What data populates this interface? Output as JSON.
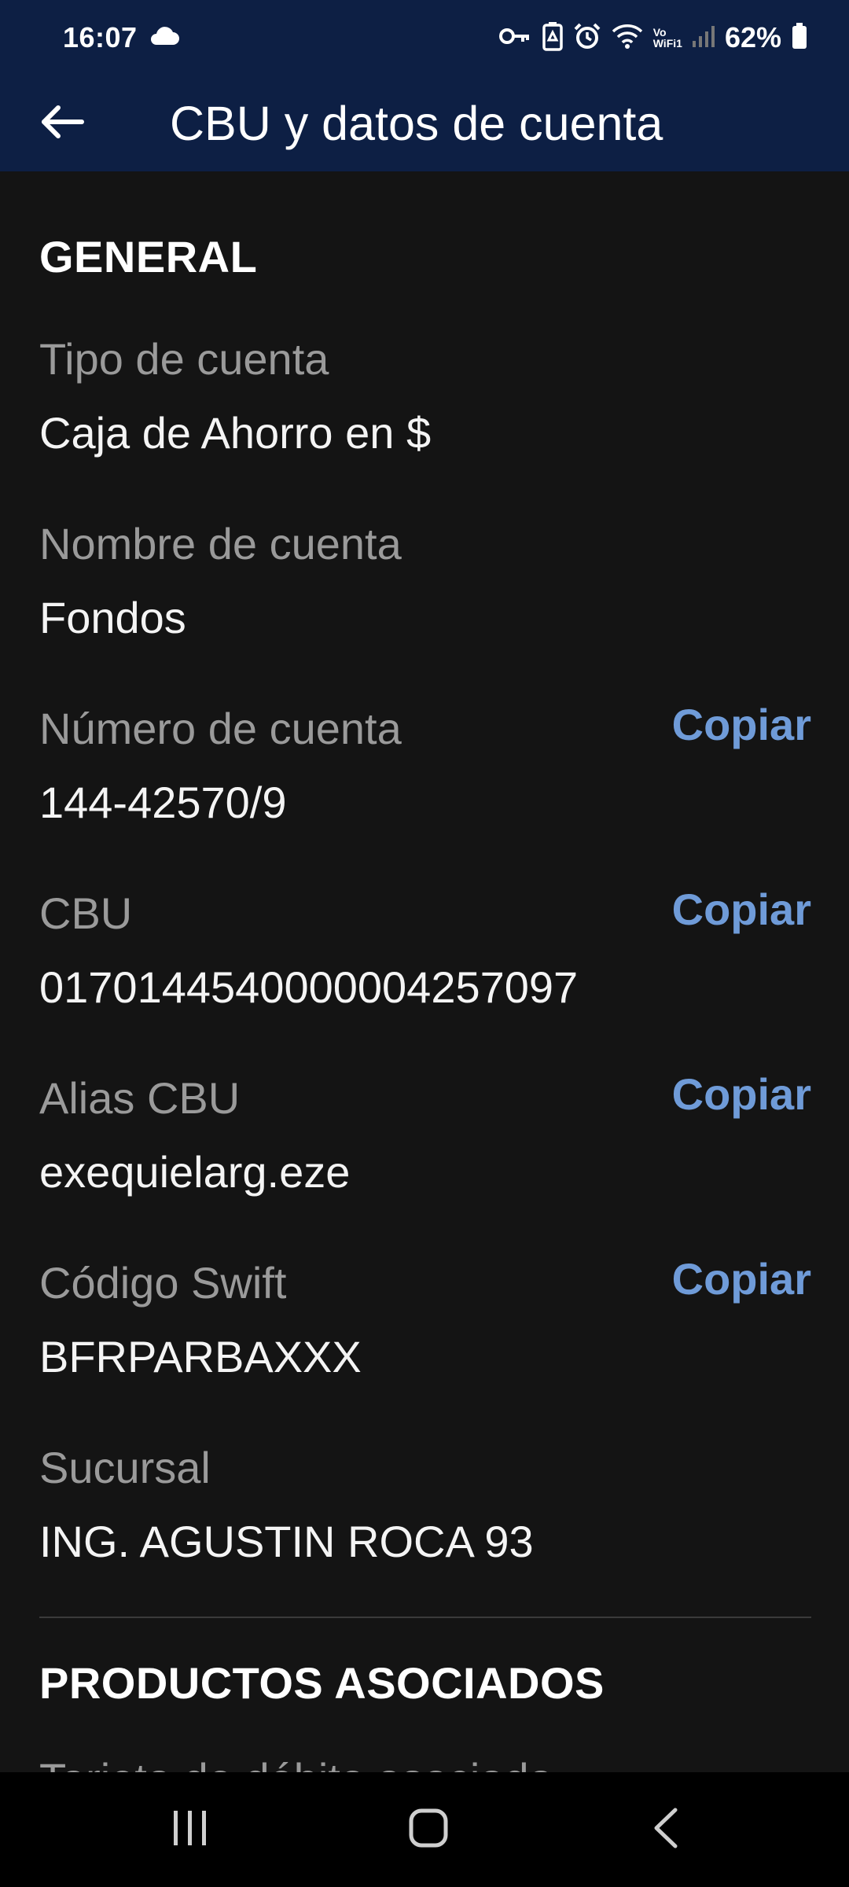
{
  "status_bar": {
    "time": "16:07",
    "battery": "62%",
    "icons": [
      "cloud-icon",
      "key-icon",
      "battery-saver-icon",
      "alarm-icon",
      "wifi-icon",
      "vowifi-icon",
      "signal-icon",
      "battery-icon"
    ],
    "vowifi_label_top": "Vo",
    "vowifi_label_bottom": "WiFi1"
  },
  "app_bar": {
    "title": "CBU y datos de cuenta",
    "back_icon": "arrow-left-icon"
  },
  "sections": {
    "general": {
      "heading": "GENERAL",
      "fields": [
        {
          "label": "Tipo de cuenta",
          "value": "Caja de Ahorro en $"
        },
        {
          "label": "Nombre de cuenta",
          "value": "Fondos"
        },
        {
          "label": "Número de cuenta",
          "value": "144-42570/9",
          "action": "Copiar"
        },
        {
          "label": "CBU",
          "value": "0170144540000004257097",
          "action": "Copiar"
        },
        {
          "label": "Alias CBU",
          "value": "exequielarg.eze",
          "action": "Copiar"
        },
        {
          "label": "Código Swift",
          "value": "BFRPARBAXXX",
          "action": "Copiar"
        },
        {
          "label": "Sucursal",
          "value": "ING. AGUSTIN ROCA 93"
        }
      ]
    },
    "productos": {
      "heading": "PRODUCTOS ASOCIADOS",
      "peek_text": "Tarjeta de débito asociada"
    }
  },
  "colors": {
    "header_bg": "#0d1f44",
    "content_bg": "#141414",
    "accent_link": "#6f9bd8",
    "label_gray": "#9a9a9a"
  },
  "nav_bar": {
    "recents_icon": "recents-icon",
    "home_icon": "home-icon",
    "back_icon": "back-chevron-icon"
  }
}
